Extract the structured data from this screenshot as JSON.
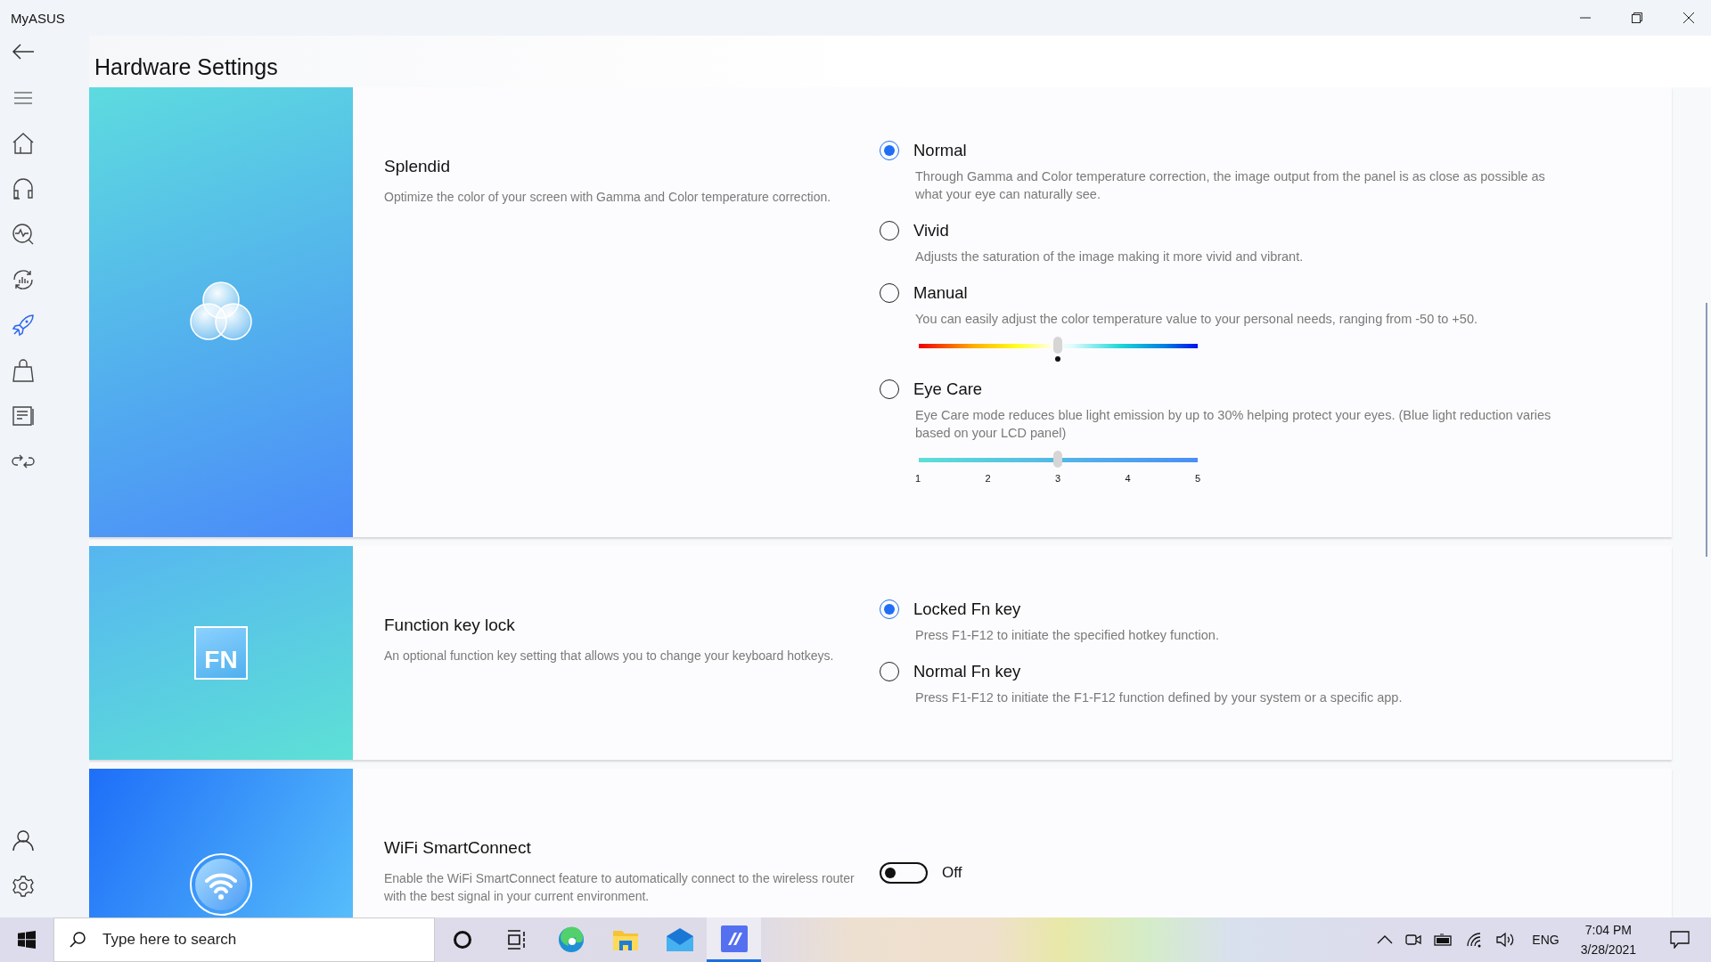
{
  "window": {
    "title": "MyASUS"
  },
  "sidebar": {
    "top_buttons": [
      {
        "kind": "back"
      },
      {
        "kind": "menu"
      }
    ],
    "nav_items": [
      {
        "kind": "home",
        "selected": false
      },
      {
        "kind": "headset",
        "selected": false
      },
      {
        "kind": "diagnosis",
        "selected": false
      },
      {
        "kind": "refresh",
        "selected": false
      },
      {
        "kind": "rocket",
        "selected": true
      },
      {
        "kind": "bag",
        "selected": false
      },
      {
        "kind": "list",
        "selected": false
      },
      {
        "kind": "link",
        "selected": false
      }
    ],
    "bottom_items": [
      {
        "kind": "user"
      },
      {
        "kind": "gear"
      }
    ]
  },
  "page_title": "Hardware Settings",
  "sections": [
    {
      "kind": "splendid",
      "title": "Splendid",
      "description": "Optimize the color of your screen with Gamma and Color temperature correction.",
      "options": [
        {
          "label": "Normal",
          "description": "Through Gamma and Color temperature correction, the image output from the panel is as close as possible as what your eye can naturally see.",
          "selected": true
        },
        {
          "label": "Vivid",
          "description": "Adjusts the saturation of the image making it more vivid and vibrant.",
          "selected": false
        },
        {
          "label": "Manual",
          "description": "You can easily adjust the color temperature value to your personal needs, ranging from -50 to +50.",
          "selected": false,
          "slider": {
            "kind": "temperature",
            "level": 0.5
          }
        },
        {
          "label": "Eye Care",
          "description": "Eye Care mode reduces blue light emission by up to 30% helping protect your eyes. (Blue light reduction varies based on your LCD panel)",
          "selected": false,
          "slider": {
            "kind": "eye_care",
            "level": 0.5,
            "ticks": [
              "1",
              "2",
              "3",
              "4",
              "5"
            ]
          }
        }
      ]
    },
    {
      "kind": "fn",
      "badge": "FN",
      "title": "Function key lock",
      "description": "An optional function key setting that allows you to change your keyboard hotkeys.",
      "options": [
        {
          "label": "Locked Fn key",
          "description": "Press F1-F12 to initiate the specified hotkey function.",
          "selected": true
        },
        {
          "label": "Normal Fn key",
          "description": "Press F1-F12 to initiate the F1-F12 function defined by your system or a specific app.",
          "selected": false
        }
      ]
    },
    {
      "kind": "wifi",
      "title": "WiFi SmartConnect",
      "description": "Enable the WiFi SmartConnect feature to automatically connect to the wireless router with the best signal in your current environment.",
      "toggle": {
        "on": false,
        "label": "Off"
      }
    }
  ],
  "taskbar": {
    "search": {
      "placeholder": "Type here to search"
    },
    "apps": [
      {
        "kind": "cortana",
        "selected": false
      },
      {
        "kind": "task_view",
        "selected": false
      },
      {
        "kind": "edge",
        "selected": false
      },
      {
        "kind": "explorer",
        "selected": false
      },
      {
        "kind": "mail",
        "selected": false
      },
      {
        "kind": "myasus",
        "selected": true
      }
    ],
    "tray": [
      {
        "kind": "chevron"
      },
      {
        "kind": "meet"
      },
      {
        "kind": "battery"
      },
      {
        "kind": "wifi"
      },
      {
        "kind": "volume"
      }
    ],
    "language": "ENG",
    "time": "7:04 PM",
    "date": "3/28/2021"
  }
}
